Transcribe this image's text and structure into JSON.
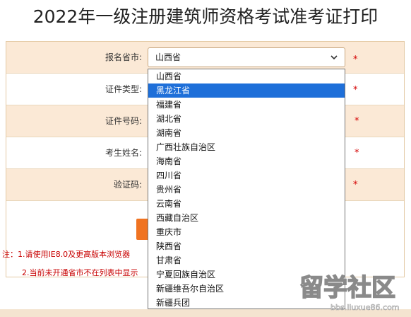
{
  "title": "2022年一级注册建筑师资格考试准考证打印",
  "form": {
    "fields": [
      {
        "label": "报名省市:",
        "required_mark": "*"
      },
      {
        "label": "证件类型:",
        "required_mark": "*"
      },
      {
        "label": "证件号码:",
        "required_mark": "*"
      },
      {
        "label": "考生姓名:",
        "required_mark": "*"
      },
      {
        "label": "验证码:",
        "required_mark": "*"
      }
    ],
    "province_select": {
      "selected_value": "山西省",
      "options": [
        "山西省",
        "黑龙江省",
        "福建省",
        "湖北省",
        "湖南省",
        "广西壮族自治区",
        "海南省",
        "四川省",
        "贵州省",
        "云南省",
        "西藏自治区",
        "重庆市",
        "陕西省",
        "甘肃省",
        "宁夏回族自治区",
        "新疆维吾尔自治区",
        "新疆兵团"
      ],
      "highlighted_option": "黑龙江省"
    }
  },
  "notes": {
    "note_1": "注：1.请使用IE8.0及更高版本浏览器",
    "note_2": "2.当前未开通省市不在列表中显示"
  },
  "watermark": {
    "text": "留学社区",
    "url_text": "bbs.liuxue86.com"
  },
  "colors": {
    "row_tint": "#fbe9d6",
    "required": "#d40000",
    "highlight": "#1e6fd9",
    "button": "#f07321"
  }
}
